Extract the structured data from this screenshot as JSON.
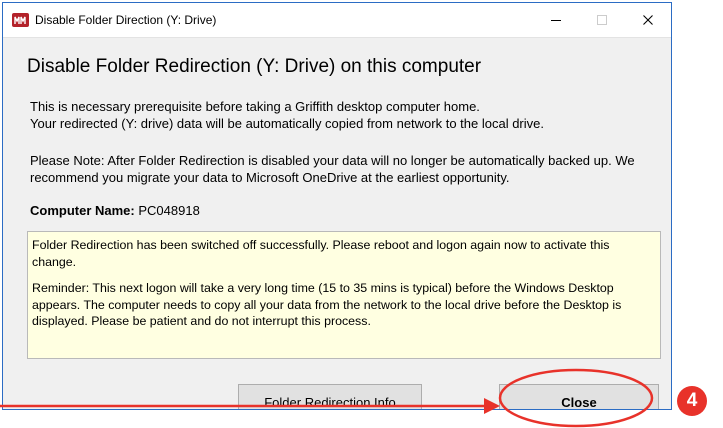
{
  "window": {
    "title": "Disable Folder Direction (Y: Drive)",
    "icon": "griffith-app-icon"
  },
  "controls": {
    "minimize": "minimize-icon",
    "maximize": "maximize-icon",
    "close": "close-icon"
  },
  "dialog": {
    "heading": "Disable Folder Redirection (Y: Drive) on this computer",
    "para1_line1": "This is necessary prerequisite before taking a Griffith desktop computer home.",
    "para1_line2": "Your redirected (Y: drive) data will be automatically copied from network to the local drive.",
    "para2": "Please Note: After Folder Redirection is disabled your data will no longer be automatically backed up. We recommend you migrate your data to Microsoft OneDrive at the earliest opportunity.",
    "computer_label": "Computer Name:",
    "computer_value": "PC048918",
    "status_line1": "Folder Redirection has been switched off successfully. Please reboot and logon again now to activate this change.",
    "status_line2": "Reminder: This next logon will take a very long time (15 to 35 mins is typical) before the Windows Desktop appears. The computer needs to copy all your data from the network to the local drive before the Desktop is displayed. Please be patient and do not interrupt this process."
  },
  "buttons": {
    "info_label": "Folder Redirection Info",
    "close_label": "Close"
  },
  "annotation": {
    "step_number": "4",
    "color": "#e8322a"
  },
  "colors": {
    "window_border": "#2b6cc4",
    "dialog_bg": "#f0f0f0",
    "status_bg": "#ffffe1",
    "button_bg": "#e1e1e1"
  }
}
